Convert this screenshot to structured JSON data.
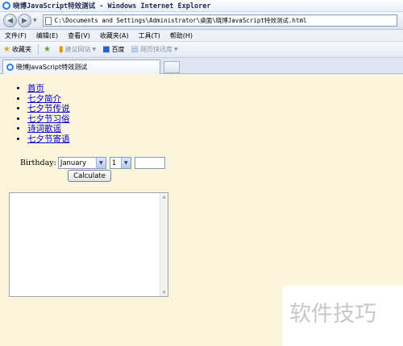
{
  "window": {
    "title": "晓博JavaScript特效测试 - Windows Internet Explorer"
  },
  "address": {
    "url": "C:\\Documents and Settings\\Administrator\\桌面\\晓博JavaScript特效测试.html"
  },
  "menu": {
    "items": [
      "文件(F)",
      "编辑(E)",
      "查看(V)",
      "收藏夹(A)",
      "工具(T)",
      "帮助(H)"
    ]
  },
  "favorites": {
    "label": "收藏夹",
    "suggested": "建议网站",
    "baidu": "百度",
    "quicklib": "网页快讯库"
  },
  "tab": {
    "title": "晓博JavaScript特效测试"
  },
  "page": {
    "links": [
      "首页",
      "七夕简介",
      "七夕节传说",
      "七夕节习俗",
      "诗词歌谣",
      "七夕节寄语"
    ],
    "birthday_label": "Birthday:",
    "month_selected": "January",
    "day_selected": "1",
    "year_value": "",
    "calculate_label": "Calculate",
    "result_text": ""
  },
  "watermark": "软件技巧",
  "colors": {
    "page_background": "#fdf4dc",
    "link": "#0000cc"
  }
}
